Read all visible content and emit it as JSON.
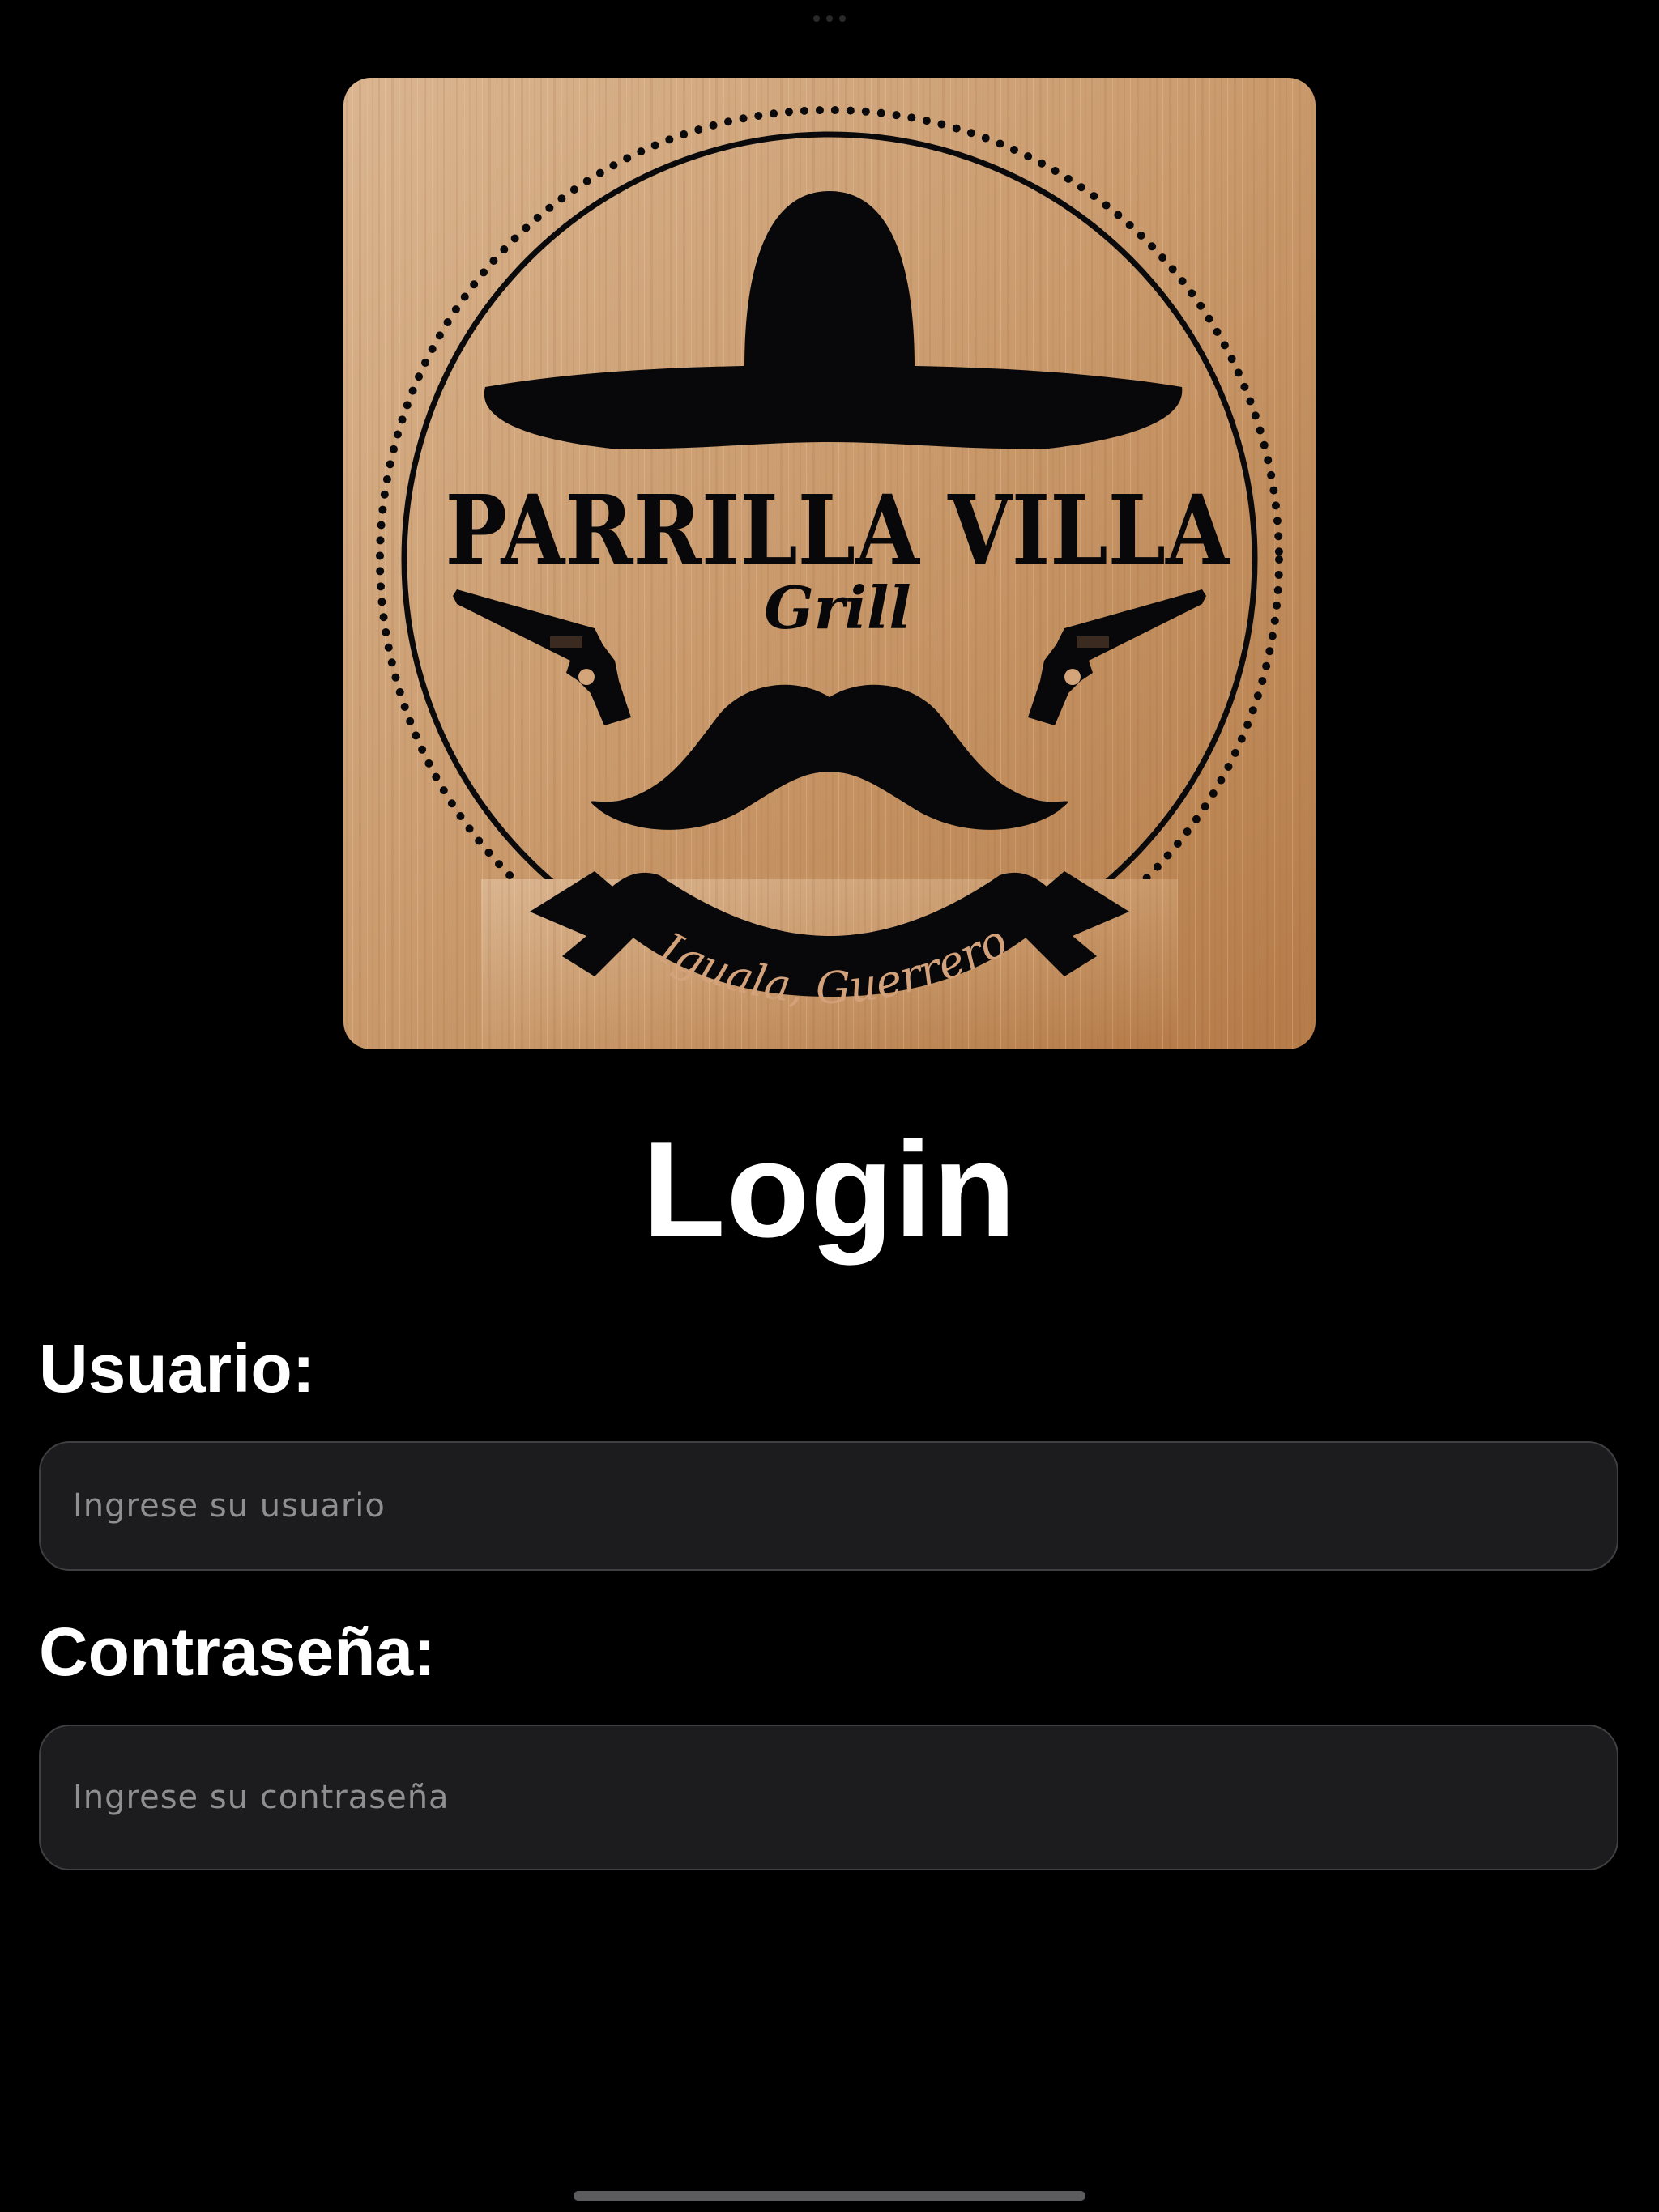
{
  "logo": {
    "brand_name": "PARRILLA VILLA",
    "brand_sub": "Grill",
    "location": "Iguala, Guerrero"
  },
  "login": {
    "title": "Login",
    "username_label": "Usuario:",
    "username_placeholder": "Ingrese su usuario",
    "password_label": "Contraseña:",
    "password_placeholder": "Ingrese su contraseña"
  },
  "colors": {
    "background": "#000000",
    "input_background": "#1c1c1e",
    "input_border": "#3f3f41",
    "wood_light": "#e0bd97",
    "wood_dark": "#b47c4b",
    "ink": "#08080a"
  }
}
